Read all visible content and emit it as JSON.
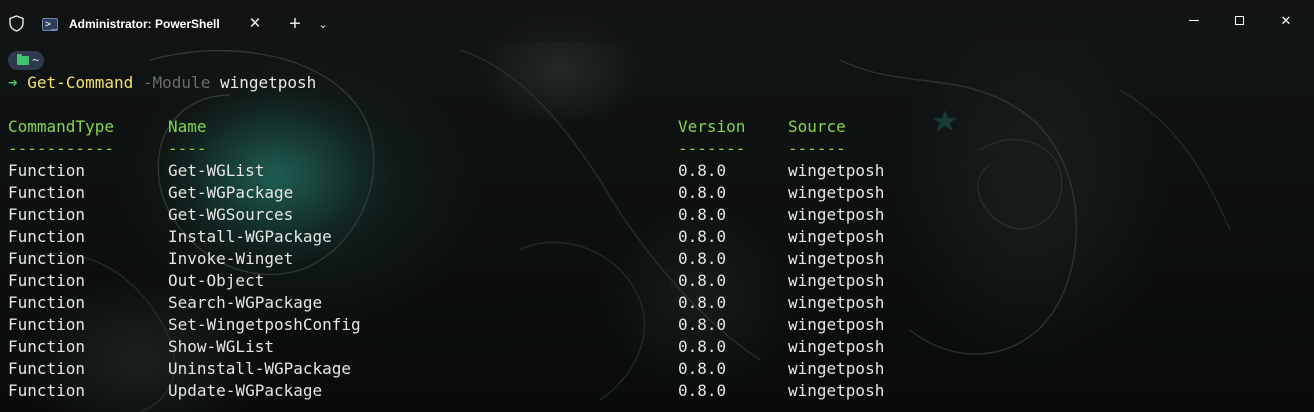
{
  "window": {
    "tab_title": "Administrator: PowerShell",
    "tab_icon_glyph": ">_",
    "new_tab_label": "+",
    "close_tab_label": "✕",
    "close_window_label": "✕",
    "dropdown_label": "⌄"
  },
  "prompt": {
    "folder": "~",
    "arrow": "➜",
    "command": "Get-Command",
    "parameter": "-Module",
    "argument": "wingetposh"
  },
  "table": {
    "headers": [
      "CommandType",
      "Name",
      "Version",
      "Source"
    ],
    "separators": [
      "-----------",
      "----",
      "-------",
      "------"
    ],
    "rows": [
      [
        "Function",
        "Get-WGList",
        "0.8.0",
        "wingetposh"
      ],
      [
        "Function",
        "Get-WGPackage",
        "0.8.0",
        "wingetposh"
      ],
      [
        "Function",
        "Get-WGSources",
        "0.8.0",
        "wingetposh"
      ],
      [
        "Function",
        "Install-WGPackage",
        "0.8.0",
        "wingetposh"
      ],
      [
        "Function",
        "Invoke-Winget",
        "0.8.0",
        "wingetposh"
      ],
      [
        "Function",
        "Out-Object",
        "0.8.0",
        "wingetposh"
      ],
      [
        "Function",
        "Search-WGPackage",
        "0.8.0",
        "wingetposh"
      ],
      [
        "Function",
        "Set-WingetposhConfig",
        "0.8.0",
        "wingetposh"
      ],
      [
        "Function",
        "Show-WGList",
        "0.8.0",
        "wingetposh"
      ],
      [
        "Function",
        "Uninstall-WGPackage",
        "0.8.0",
        "wingetposh"
      ],
      [
        "Function",
        "Update-WGPackage",
        "0.8.0",
        "wingetposh"
      ]
    ]
  },
  "colors": {
    "header_text": "#84d64d",
    "command_text": "#f4e26a",
    "parameter_text": "#6c6c6c",
    "prompt_arrow": "#46c36b",
    "badge_bg": "#2f3b4c",
    "folder_icon": "#3fc36f"
  }
}
